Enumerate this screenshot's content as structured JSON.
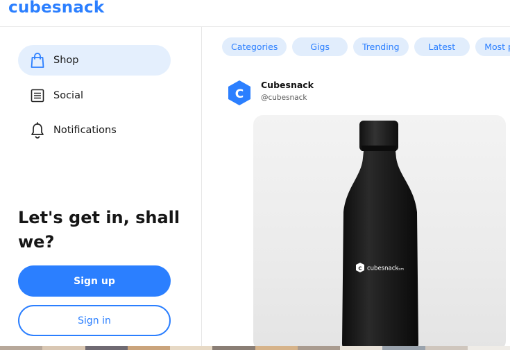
{
  "brand": {
    "name": "cubesnack"
  },
  "sidebar": {
    "items": [
      {
        "label": "Shop",
        "icon": "shopping-bag-icon",
        "active": true
      },
      {
        "label": "Social",
        "icon": "document-list-icon",
        "active": false
      },
      {
        "label": "Notifications",
        "icon": "bell-icon",
        "active": false
      }
    ],
    "cta": {
      "title": "Let's get in, shall we?",
      "signup_label": "Sign up",
      "signin_label": "Sign in"
    }
  },
  "categories": {
    "chips": [
      "Categories",
      "Gigs",
      "Trending",
      "Latest",
      "Most pop"
    ]
  },
  "post": {
    "author_name": "Cubesnack",
    "author_handle": "@cubesnack",
    "avatar_letter": "C",
    "product_logo_text": "cubesnack",
    "product_logo_suffix": ".com"
  },
  "colors": {
    "accent": "#2b7fff",
    "accent_light": "#e4effd",
    "bottle": "#1c1c1c"
  }
}
